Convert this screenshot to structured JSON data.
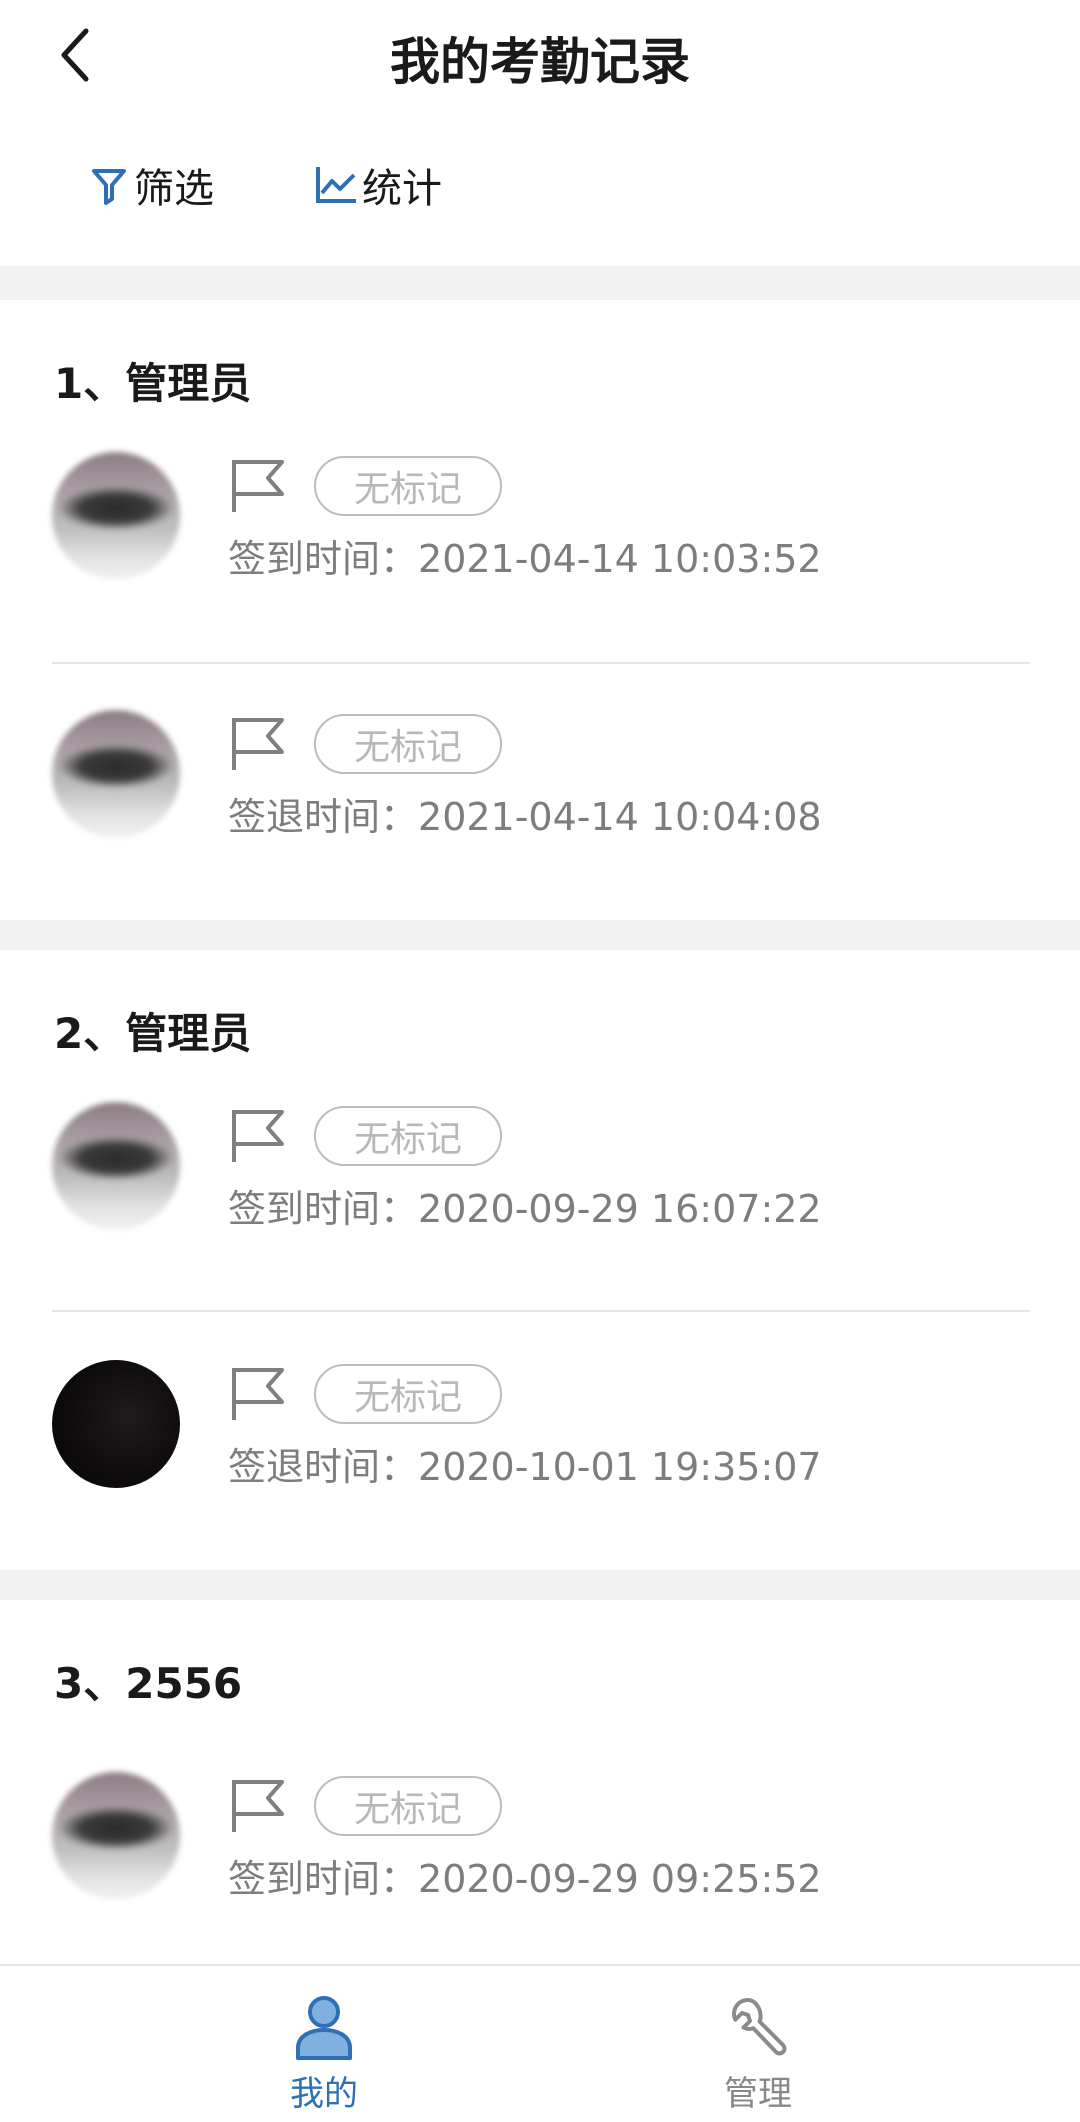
{
  "header": {
    "title": "我的考勤记录"
  },
  "toolbar": {
    "filter_label": "筛选",
    "stats_label": "统计"
  },
  "groups": [
    {
      "title": "1、管理员",
      "records": [
        {
          "tag": "无标记",
          "time_label": "签到时间：",
          "time": "2021-04-14 10:03:52",
          "avatar": "blurred"
        },
        {
          "tag": "无标记",
          "time_label": "签退时间：",
          "time": "2021-04-14 10:04:08",
          "avatar": "blurred"
        }
      ]
    },
    {
      "title": "2、管理员",
      "records": [
        {
          "tag": "无标记",
          "time_label": "签到时间：",
          "time": "2020-09-29 16:07:22",
          "avatar": "blurred"
        },
        {
          "tag": "无标记",
          "time_label": "签退时间：",
          "time": "2020-10-01 19:35:07",
          "avatar": "dark"
        }
      ]
    },
    {
      "title": "3、2556",
      "records": [
        {
          "tag": "无标记",
          "time_label": "签到时间：",
          "time": "2020-09-29 09:25:52",
          "avatar": "blurred"
        }
      ]
    }
  ],
  "bottom_nav": {
    "mine_label": "我的",
    "manage_label": "管理",
    "active": "mine"
  },
  "icons": {
    "back": "chevron-left-icon",
    "filter": "filter-icon",
    "stats": "line-chart-icon",
    "flag": "flag-icon",
    "mine": "user-icon",
    "manage": "wrench-icon"
  },
  "colors": {
    "accent": "#2f6fb4",
    "inactive": "#888888",
    "separator": "#f2f2f2"
  }
}
